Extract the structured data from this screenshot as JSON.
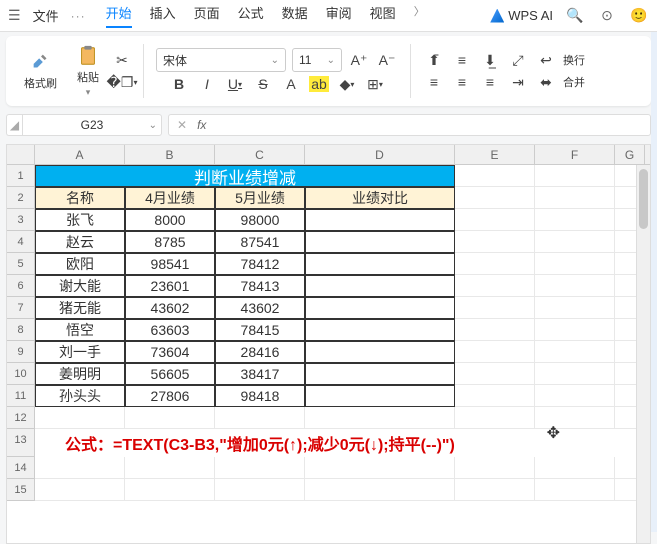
{
  "titlebar": {
    "file": "文件",
    "more": "···",
    "ai": "WPS AI"
  },
  "tabs": {
    "start": "开始",
    "insert": "插入",
    "page": "页面",
    "formula": "公式",
    "data": "数据",
    "review": "审阅",
    "view": "视图"
  },
  "ribbon": {
    "format_painter": "格式刷",
    "paste": "粘贴",
    "font_name": "宋体",
    "font_size": "11",
    "wrap": "换行",
    "merge": "合并"
  },
  "namebox": "G23",
  "formula_bar": "",
  "columns": [
    "A",
    "B",
    "C",
    "D",
    "E",
    "F",
    "G"
  ],
  "title_merged": "判断业绩增减",
  "headers": {
    "name": "名称",
    "apr": "4月业绩",
    "may": "5月业绩",
    "cmp": "业绩对比"
  },
  "rows": [
    {
      "name": "张飞",
      "apr": "8000",
      "may": "98000"
    },
    {
      "name": "赵云",
      "apr": "8785",
      "may": "87541"
    },
    {
      "name": "欧阳",
      "apr": "98541",
      "may": "78412"
    },
    {
      "name": "谢大能",
      "apr": "23601",
      "may": "78413"
    },
    {
      "name": "猪无能",
      "apr": "43602",
      "may": "43602"
    },
    {
      "name": "悟空",
      "apr": "63603",
      "may": "78415"
    },
    {
      "name": "刘一手",
      "apr": "73604",
      "may": "28416"
    },
    {
      "name": "姜明明",
      "apr": "56605",
      "may": "38417"
    },
    {
      "name": "孙头头",
      "apr": "27806",
      "may": "98418"
    }
  ],
  "formula_note": "公式：=TEXT(C3-B3,\"增加0元(↑);减少0元(↓);持平(--)\")",
  "icons": {
    "search": "⌕",
    "cloud": "☁",
    "user": "👤",
    "chev": "⌄",
    "brush": "✎",
    "paste": "📋",
    "scissors": "✂",
    "copy": "⎘"
  }
}
